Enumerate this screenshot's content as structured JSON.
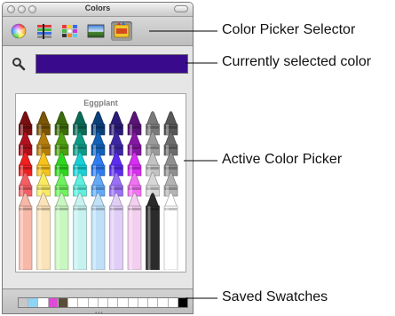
{
  "window": {
    "title": "Colors"
  },
  "toolbar": {
    "buttons": [
      {
        "name": "color-wheel-icon",
        "selected": false
      },
      {
        "name": "color-sliders-icon",
        "selected": false
      },
      {
        "name": "color-palettes-icon",
        "selected": false
      },
      {
        "name": "image-palettes-icon",
        "selected": false
      },
      {
        "name": "crayons-icon",
        "selected": true
      }
    ]
  },
  "current_color": {
    "hex": "#3a0a8c"
  },
  "picker": {
    "selected_name": "Eggplant",
    "crayon_rows": [
      [
        "#7a0f12",
        "#7a5508",
        "#3b6b0c",
        "#0a6a55",
        "#0b3f7a",
        "#2c1a78",
        "#5a1476",
        "#7a7a7a",
        "#585858"
      ],
      [
        "#b1111c",
        "#b57d0b",
        "#4f9f12",
        "#0d9a85",
        "#1161b7",
        "#3d26a6",
        "#8517a3",
        "#9b9b9b",
        "#6c6c6c"
      ],
      [
        "#f0201f",
        "#f4c31d",
        "#2fd51f",
        "#17d0d6",
        "#2f7cf0",
        "#5b2cf0",
        "#d62ef2",
        "#c3c3c3",
        "#8f8f8f"
      ],
      [
        "#f45f66",
        "#f9ea61",
        "#6ef25d",
        "#5cf0e0",
        "#63a9f7",
        "#9a70f6",
        "#f172f2",
        "#d7d7d7",
        "#b3b3b3"
      ],
      [
        "#f7b8a7",
        "#fae3b8",
        "#c9f7c0",
        "#c6f2ef",
        "#bfe0f7",
        "#e1cef7",
        "#f2cfee",
        "#2b2b2b",
        "#ffffff"
      ]
    ]
  },
  "saved_swatches": [
    "#c7c7c7",
    "#8fd3f5",
    "#ffffff",
    "#e04ad8",
    "#5a4e3a",
    "#ffffff",
    "#ffffff",
    "#ffffff",
    "#ffffff",
    "#ffffff",
    "#ffffff",
    "#ffffff",
    "#ffffff",
    "#ffffff",
    "#ffffff",
    "#ffffff",
    "#000000"
  ],
  "callouts": {
    "selector": "Color Picker Selector",
    "current": "Currently selected color",
    "active": "Active Color Picker",
    "swatches": "Saved Swatches"
  }
}
